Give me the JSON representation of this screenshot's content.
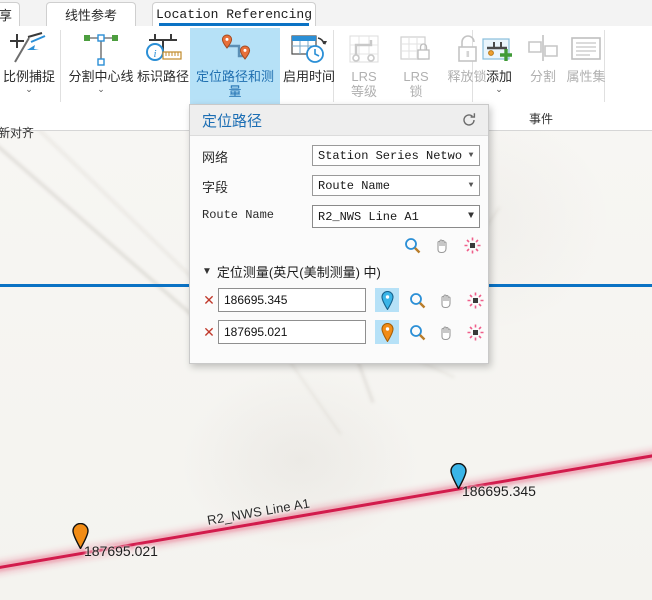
{
  "app": {
    "tabs": [
      {
        "name": "tab-share",
        "label": "享"
      },
      {
        "name": "tab-linear-reference",
        "label": "线性参考"
      },
      {
        "name": "tab-location-referencing",
        "label": "Location Referencing"
      }
    ],
    "active_tab": "Location Referencing"
  },
  "ribbon": {
    "groups": [
      {
        "label": "事件"
      }
    ],
    "buttons": [
      {
        "name": "proportional-snap",
        "label": "比例捕捉",
        "icon": "snap-icon",
        "has_caret": true,
        "enabled": true,
        "active": false
      },
      {
        "name": "split-centerline",
        "label": "分割中心线",
        "icon": "split-centerline-icon",
        "has_caret": true,
        "enabled": true,
        "active": false
      },
      {
        "name": "identify-route",
        "label": "标识路径",
        "icon": "identify-route-icon",
        "has_caret": false,
        "enabled": true,
        "active": false
      },
      {
        "name": "locate-route-and-measure",
        "label": "定位路径和测量",
        "icon": "locate-route-icon",
        "has_caret": true,
        "enabled": true,
        "active": true
      },
      {
        "name": "enable-time",
        "label": "启用时间",
        "icon": "enable-time-icon",
        "has_caret": false,
        "enabled": true,
        "active": false
      },
      {
        "name": "lrs-level",
        "label": "LRS\n等级",
        "icon": "lrs-level-icon",
        "has_caret": false,
        "enabled": false,
        "active": false
      },
      {
        "name": "lrs-lock",
        "label": "LRS\n锁",
        "icon": "lrs-lock-icon",
        "has_caret": false,
        "enabled": false,
        "active": false
      },
      {
        "name": "release-lock",
        "label": "释放锁",
        "icon": "unlock-icon",
        "has_caret": false,
        "enabled": false,
        "active": false
      },
      {
        "name": "add-event",
        "label": "添加",
        "icon": "add-event-icon",
        "has_caret": true,
        "enabled": true,
        "active": false
      },
      {
        "name": "split-event",
        "label": "分割",
        "icon": "split-event-icon",
        "has_caret": false,
        "enabled": false,
        "active": false
      },
      {
        "name": "attribute-set",
        "label": "属性集",
        "icon": "attribute-set-icon",
        "has_caret": false,
        "enabled": false,
        "active": false
      }
    ],
    "partial_label_bottom_left": "重新对齐"
  },
  "panel": {
    "title": "定位路径",
    "refresh_icon": "refresh-icon",
    "fields": [
      {
        "name": "network",
        "label": "网络",
        "value": "Station Series Network",
        "mono_label": false
      },
      {
        "name": "field",
        "label": "字段",
        "value": "Route Name",
        "mono_label": false
      },
      {
        "name": "route-name",
        "label": "Route Name",
        "value": "R2_NWS Line A1",
        "mono_label": true
      }
    ],
    "route_actions": [
      {
        "name": "zoom-to-route",
        "icon": "magnifier-icon"
      },
      {
        "name": "pan-to-route",
        "icon": "pan-hand-icon"
      },
      {
        "name": "flash-route",
        "icon": "flash-icon"
      }
    ],
    "measure_section": {
      "name": "locate-measure-section",
      "label": "定位测量(英尺(美制测量) 中)",
      "chevron": "chevron-down-icon",
      "rows": [
        {
          "name": "measure-row-1",
          "value": "186695.345",
          "delete_icon": "delete-x-icon",
          "pin_color": "#3ab5e8",
          "actions": [
            {
              "name": "pick-point-1",
              "icon": "pin-icon"
            },
            {
              "name": "zoom-to-measure-1",
              "icon": "magnifier-icon"
            },
            {
              "name": "pan-to-measure-1",
              "icon": "pan-hand-icon"
            },
            {
              "name": "flash-measure-1",
              "icon": "flash-icon"
            }
          ]
        },
        {
          "name": "measure-row-2",
          "value": "187695.021",
          "delete_icon": "delete-x-icon",
          "pin_color": "#f28c15",
          "actions": [
            {
              "name": "pick-point-2",
              "icon": "pin-icon"
            },
            {
              "name": "zoom-to-measure-2",
              "icon": "magnifier-icon"
            },
            {
              "name": "pan-to-measure-2",
              "icon": "pan-hand-icon"
            },
            {
              "name": "flash-measure-2",
              "icon": "flash-icon"
            }
          ]
        }
      ]
    }
  },
  "map": {
    "route_label": "R2_NWS Line A1",
    "route_color": "#d21b4c",
    "markers": [
      {
        "name": "map-marker-186695",
        "label": "186695.345",
        "color": "#3ab5e8"
      },
      {
        "name": "map-marker-187695",
        "label": "187695.021",
        "color": "#f28c15"
      }
    ]
  },
  "colors": {
    "accent_blue": "#0a72c4",
    "highlight": "#b6e1f7",
    "route": "#d21b4c",
    "pin_blue": "#3ab5e8",
    "pin_orange": "#f28c15"
  }
}
